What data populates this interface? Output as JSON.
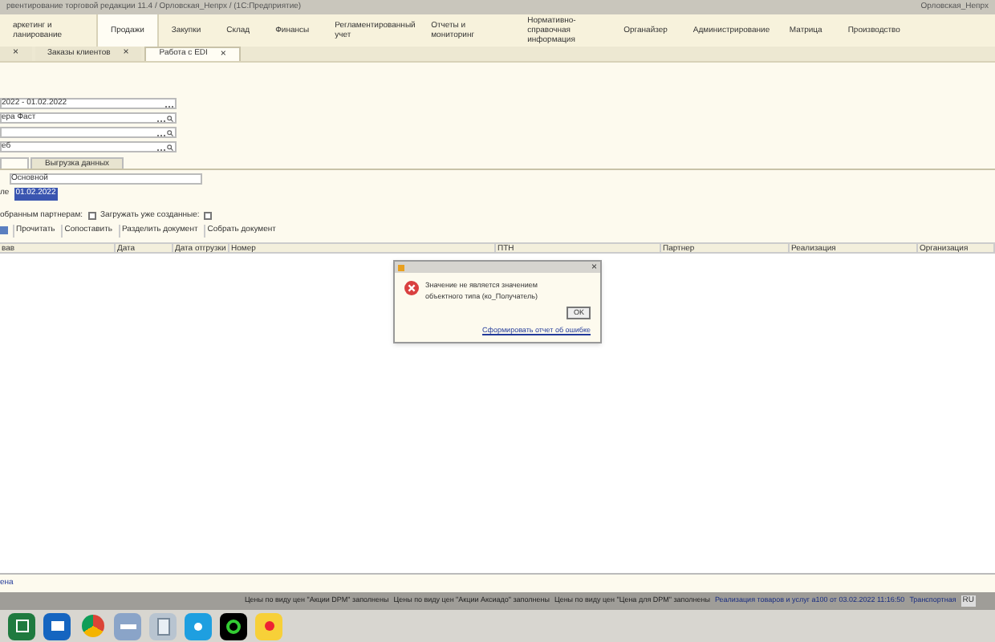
{
  "window": {
    "title": "рвентирование торговой редакции 11.4 / Орловская_Непрх / (1С:Предприятие)",
    "user": "Орловская_Непрх"
  },
  "sections": [
    {
      "label": "аркетинг и ланирование",
      "selected": false
    },
    {
      "label": "Продажи",
      "selected": true
    },
    {
      "label": "Закупки",
      "selected": false
    },
    {
      "label": "Склад",
      "selected": false
    },
    {
      "label": "Финансы",
      "selected": false
    },
    {
      "label": "Регламентированный учет",
      "selected": false
    },
    {
      "label": "Отчеты и мониторинг",
      "selected": false
    },
    {
      "label": "Нормативно-справочная информация",
      "selected": false
    },
    {
      "label": "Органайзер",
      "selected": false
    },
    {
      "label": "Администрирование",
      "selected": false
    },
    {
      "label": "Матрица",
      "selected": false
    },
    {
      "label": "Производство",
      "selected": false
    }
  ],
  "tabs": [
    {
      "selected": false
    },
    {
      "label": "Заказы клиентов",
      "selected": false
    },
    {
      "label": "Работа с EDI",
      "selected": true
    }
  ],
  "fields": [
    {
      "kind": "period",
      "value": "2022 - 01.02.2022"
    },
    {
      "kind": "lookup",
      "value": "ера Фаст"
    },
    {
      "kind": "lookup"
    },
    {
      "kind": "lookup",
      "value": "еб"
    }
  ],
  "subtabs": [
    {
      "selected": true
    },
    {
      "label": "Выгрузка данных",
      "selected": false
    }
  ],
  "profile": {
    "value": "Основной"
  },
  "date": {
    "label": "ле",
    "value": "01.02.2022"
  },
  "checkboxes": [
    {
      "label": "обранным партнерам:",
      "checked": false
    },
    {
      "label": "Загружать уже созданные:",
      "checked": false
    }
  ],
  "toolbar": [
    "Прочитать",
    "Сопоставить",
    "Разделить документ",
    "Собрать документ"
  ],
  "columns": [
    "вав",
    "Дата",
    "Дата отгрузки",
    "Номер",
    "ПТН",
    "Партнер",
    "Реализация",
    "Организация"
  ],
  "dialog": {
    "message": "Значение не является значением объектного типа (ко_Получатель)",
    "ok": "OK",
    "link": "Сформировать отчет об ошибке"
  },
  "bottom_link": "ена",
  "notifications": [
    "Цены по виду цен \"Акции DPM\" заполнены",
    "Цены по виду цен \"Акции Аксиадо\" заполнены",
    "Цены по виду цен \"Цена для DPM\" заполнены",
    "Реализация товаров и услуг а100 от 03.02.2022 11:16:50",
    "Транспортная"
  ],
  "language": "RU",
  "close_glyph": "×"
}
